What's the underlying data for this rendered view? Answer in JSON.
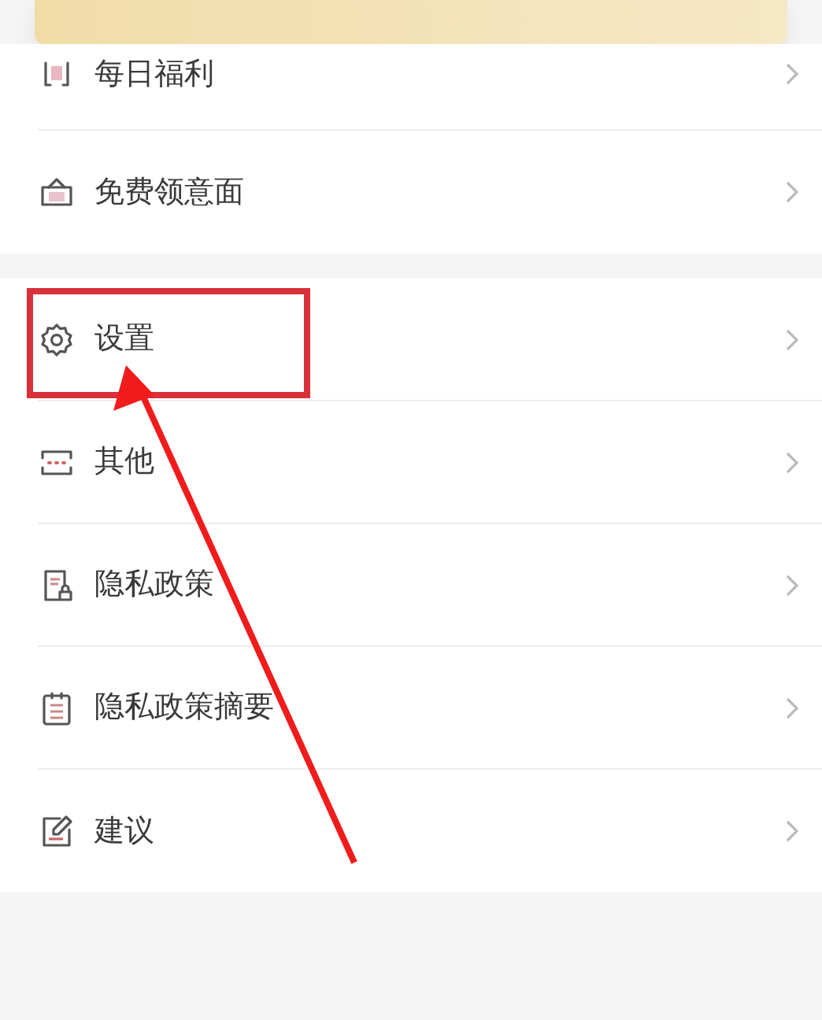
{
  "sections": [
    {
      "items": [
        {
          "label": "每日福利",
          "highlighted": false
        },
        {
          "label": "免费领意面",
          "highlighted": false
        }
      ]
    },
    {
      "items": [
        {
          "label": "设置",
          "highlighted": true
        },
        {
          "label": "其他",
          "highlighted": false
        },
        {
          "label": "隐私政策",
          "highlighted": false
        },
        {
          "label": "隐私政策摘要",
          "highlighted": false
        },
        {
          "label": "建议",
          "highlighted": false
        }
      ]
    }
  ]
}
